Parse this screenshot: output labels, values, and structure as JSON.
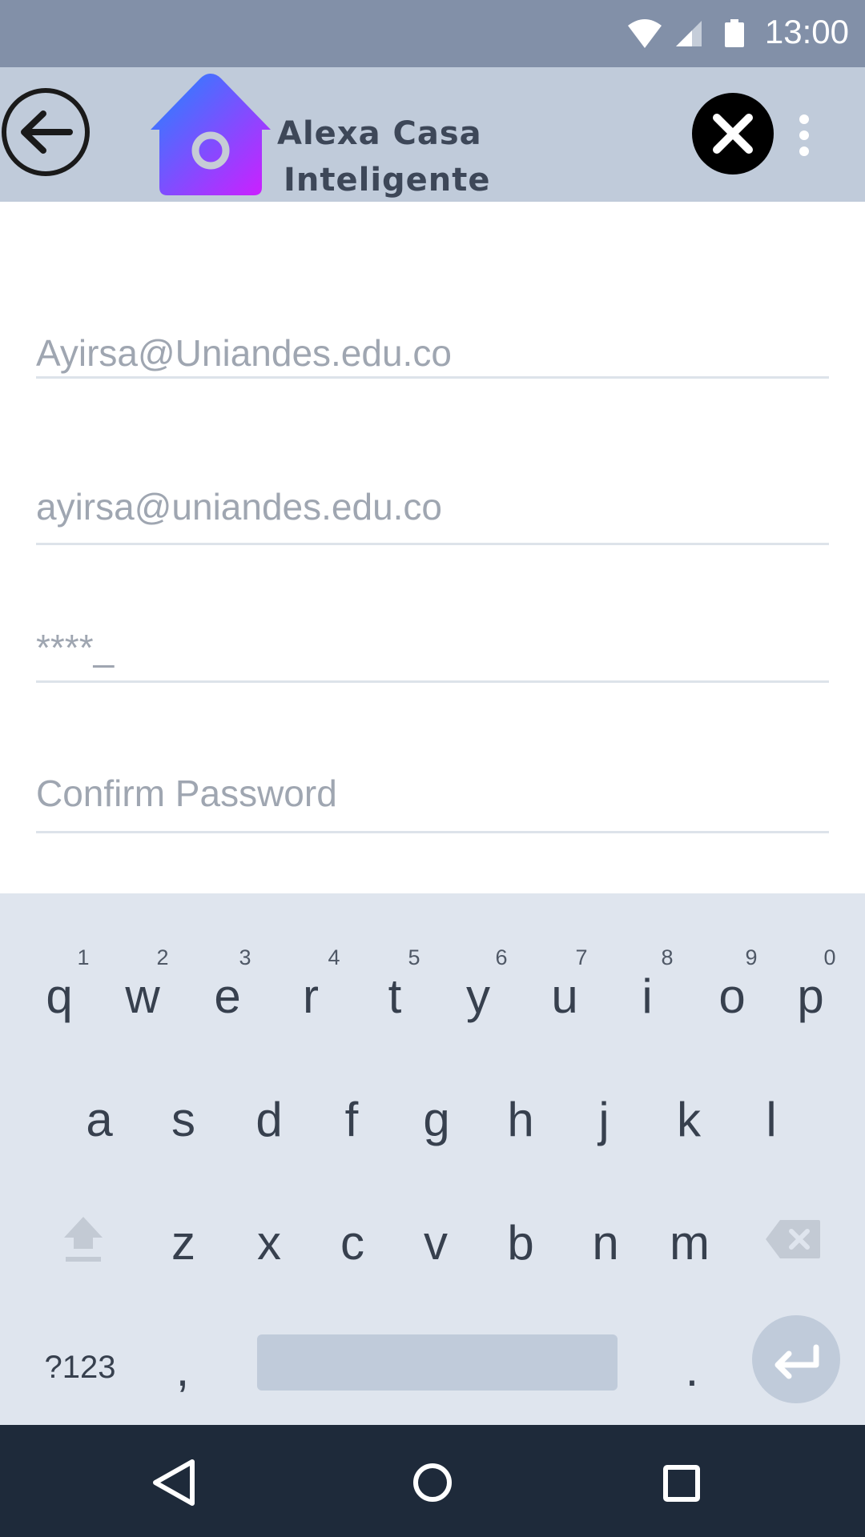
{
  "status_bar": {
    "time": "13:00",
    "icons": [
      "wifi-icon",
      "signal-icon",
      "battery-icon"
    ]
  },
  "app_bar": {
    "title_line1": "Alexa Casa",
    "title_line2": "Inteligente",
    "icons": [
      "back-arrow-icon",
      "home-logo-icon",
      "close-icon",
      "more-vert-icon"
    ]
  },
  "form": {
    "username_value": "Ayirsa@Uniandes.edu.co",
    "email_value": "ayirsa@uniandes.edu.co",
    "password_value": "****_",
    "confirm_placeholder": "Confirm Password"
  },
  "keyboard": {
    "row1": [
      {
        "key": "q",
        "hint": "1"
      },
      {
        "key": "w",
        "hint": "2"
      },
      {
        "key": "e",
        "hint": "3"
      },
      {
        "key": "r",
        "hint": "4"
      },
      {
        "key": "t",
        "hint": "5"
      },
      {
        "key": "y",
        "hint": "6"
      },
      {
        "key": "u",
        "hint": "7"
      },
      {
        "key": "i",
        "hint": "8"
      },
      {
        "key": "o",
        "hint": "9"
      },
      {
        "key": "p",
        "hint": "0"
      }
    ],
    "row2": [
      "a",
      "s",
      "d",
      "f",
      "g",
      "h",
      "j",
      "k",
      "l"
    ],
    "row3": [
      "z",
      "x",
      "c",
      "v",
      "b",
      "n",
      "m"
    ],
    "symbols_label": "?123",
    "comma_label": ",",
    "period_label": "."
  },
  "nav_bar": {
    "icons": [
      "back-triangle-icon",
      "home-circle-icon",
      "recents-square-icon"
    ]
  },
  "colors": {
    "status_bar": "#8290a8",
    "app_bar": "#c0cbda",
    "keyboard": "#dfe5ee",
    "nav_bar": "#1e2a3a",
    "logo_gradient_start": "#1e88ff",
    "logo_gradient_end": "#d21cff"
  }
}
